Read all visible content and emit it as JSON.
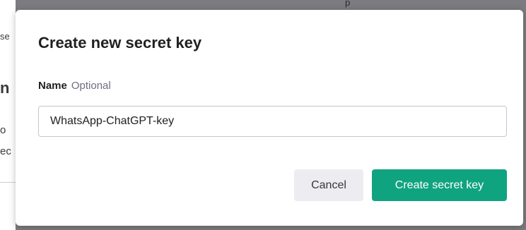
{
  "modal": {
    "title": "Create new secret key",
    "name_label": "Name",
    "name_hint": "Optional",
    "name_value": "WhatsApp-ChatGPT-key",
    "cancel_label": "Cancel",
    "create_label": "Create secret key"
  },
  "background_page": {
    "fragments": [
      "p",
      "se",
      "n",
      "o",
      "ec"
    ]
  },
  "colors": {
    "primary_button": "#10a37f",
    "secondary_button": "#ececf1",
    "overlay": "#7c7c80"
  }
}
